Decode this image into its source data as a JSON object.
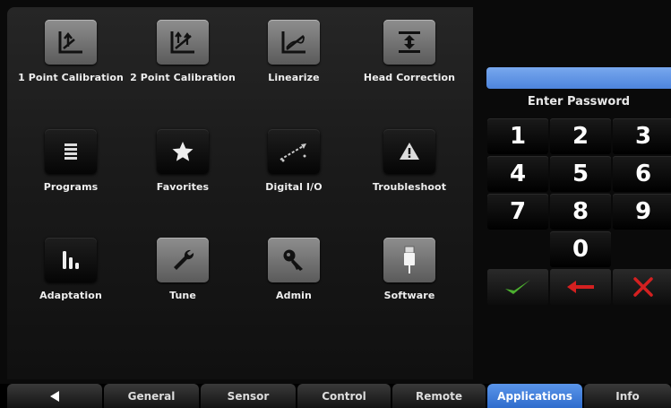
{
  "apps": [
    {
      "label": "1 Point Calibration",
      "icon": "one-point-calibration-icon",
      "style": "light"
    },
    {
      "label": "2 Point Calibration",
      "icon": "two-point-calibration-icon",
      "style": "light"
    },
    {
      "label": "Linearize",
      "icon": "linearize-icon",
      "style": "light"
    },
    {
      "label": "Head Correction",
      "icon": "head-correction-icon",
      "style": "light"
    },
    {
      "label": "Programs",
      "icon": "programs-icon",
      "style": "dark"
    },
    {
      "label": "Favorites",
      "icon": "favorites-star-icon",
      "style": "dark"
    },
    {
      "label": "Digital I/O",
      "icon": "digital-io-icon",
      "style": "dark"
    },
    {
      "label": "Troubleshoot",
      "icon": "troubleshoot-warning-icon",
      "style": "dark"
    },
    {
      "label": "Adaptation",
      "icon": "adaptation-icon",
      "style": "dark"
    },
    {
      "label": "Tune",
      "icon": "tune-wrench-icon",
      "style": "light"
    },
    {
      "label": "Admin",
      "icon": "admin-key-icon",
      "style": "light"
    },
    {
      "label": "Software",
      "icon": "software-usb-icon",
      "style": "light"
    }
  ],
  "keypad": {
    "password_label": "Enter Password",
    "keys": [
      "1",
      "2",
      "3",
      "4",
      "5",
      "6",
      "7",
      "8",
      "9",
      "0"
    ],
    "accept_icon": "checkmark-icon",
    "backspace_icon": "back-arrow-icon",
    "cancel_icon": "x-icon"
  },
  "nav": {
    "back_icon": "back-triangle-icon",
    "tabs": [
      "General",
      "Sensor",
      "Control",
      "Remote",
      "Applications",
      "Info"
    ],
    "active": "Applications"
  },
  "colors": {
    "accent_blue": "#4d84dc",
    "accept_green": "#4caf2f",
    "cancel_red": "#d42020"
  }
}
